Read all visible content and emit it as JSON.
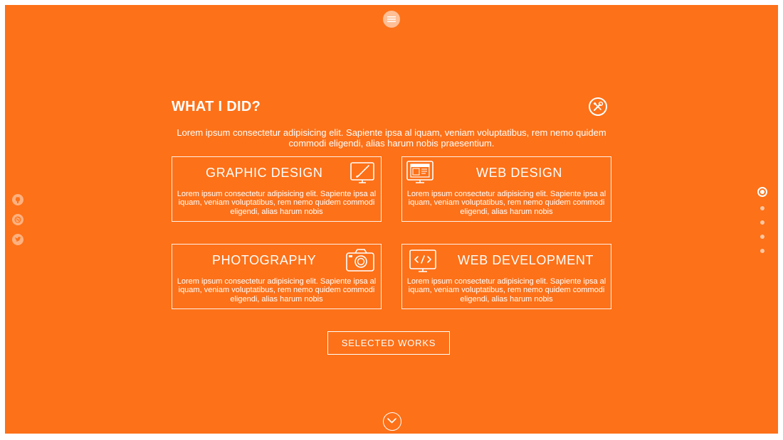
{
  "colors": {
    "background": "#fd7118",
    "foreground": "#ffffff",
    "frame": "#ffffff"
  },
  "nav": {
    "menu_icon": "hamburger-icon"
  },
  "social": [
    {
      "name": "github",
      "icon": "github-icon"
    },
    {
      "name": "dribbble",
      "icon": "dribbble-icon"
    },
    {
      "name": "twitter",
      "icon": "twitter-icon"
    }
  ],
  "section_dots": {
    "count": 5,
    "active_index": 0
  },
  "section": {
    "title": "WHAT I DID?",
    "title_icon": "tools-icon",
    "intro": "Lorem ipsum consectetur adipisicing elit. Sapiente ipsa al iquam, veniam voluptatibus, rem nemo quidem commodi eligendi, alias harum nobis praesentium."
  },
  "services": [
    {
      "title": "GRAPHIC DESIGN",
      "icon": "monitor-brush-icon",
      "text": "Lorem ipsum consectetur adipisicing elit. Sapiente ipsa al iquam, veniam voluptatibus, rem nemo quidem commodi eligendi, alias harum nobis"
    },
    {
      "title": "WEB DESIGN",
      "icon": "monitor-layout-icon",
      "text": "Lorem ipsum consectetur adipisicing elit. Sapiente ipsa al iquam, veniam voluptatibus, rem nemo quidem commodi eligendi, alias harum nobis"
    },
    {
      "title": "PHOTOGRAPHY",
      "icon": "camera-icon",
      "text": "Lorem ipsum consectetur adipisicing elit. Sapiente ipsa al iquam, veniam voluptatibus, rem nemo quidem commodi eligendi, alias harum nobis"
    },
    {
      "title": "WEB DEVELOPMENT",
      "icon": "monitor-code-icon",
      "text": "Lorem ipsum consectetur adipisicing elit. Sapiente ipsa al iquam, veniam voluptatibus, rem nemo quidem commodi eligendi, alias harum nobis"
    }
  ],
  "cta": {
    "label": "SELECTED WORKS"
  },
  "scroll": {
    "icon": "chevron-down-icon"
  }
}
